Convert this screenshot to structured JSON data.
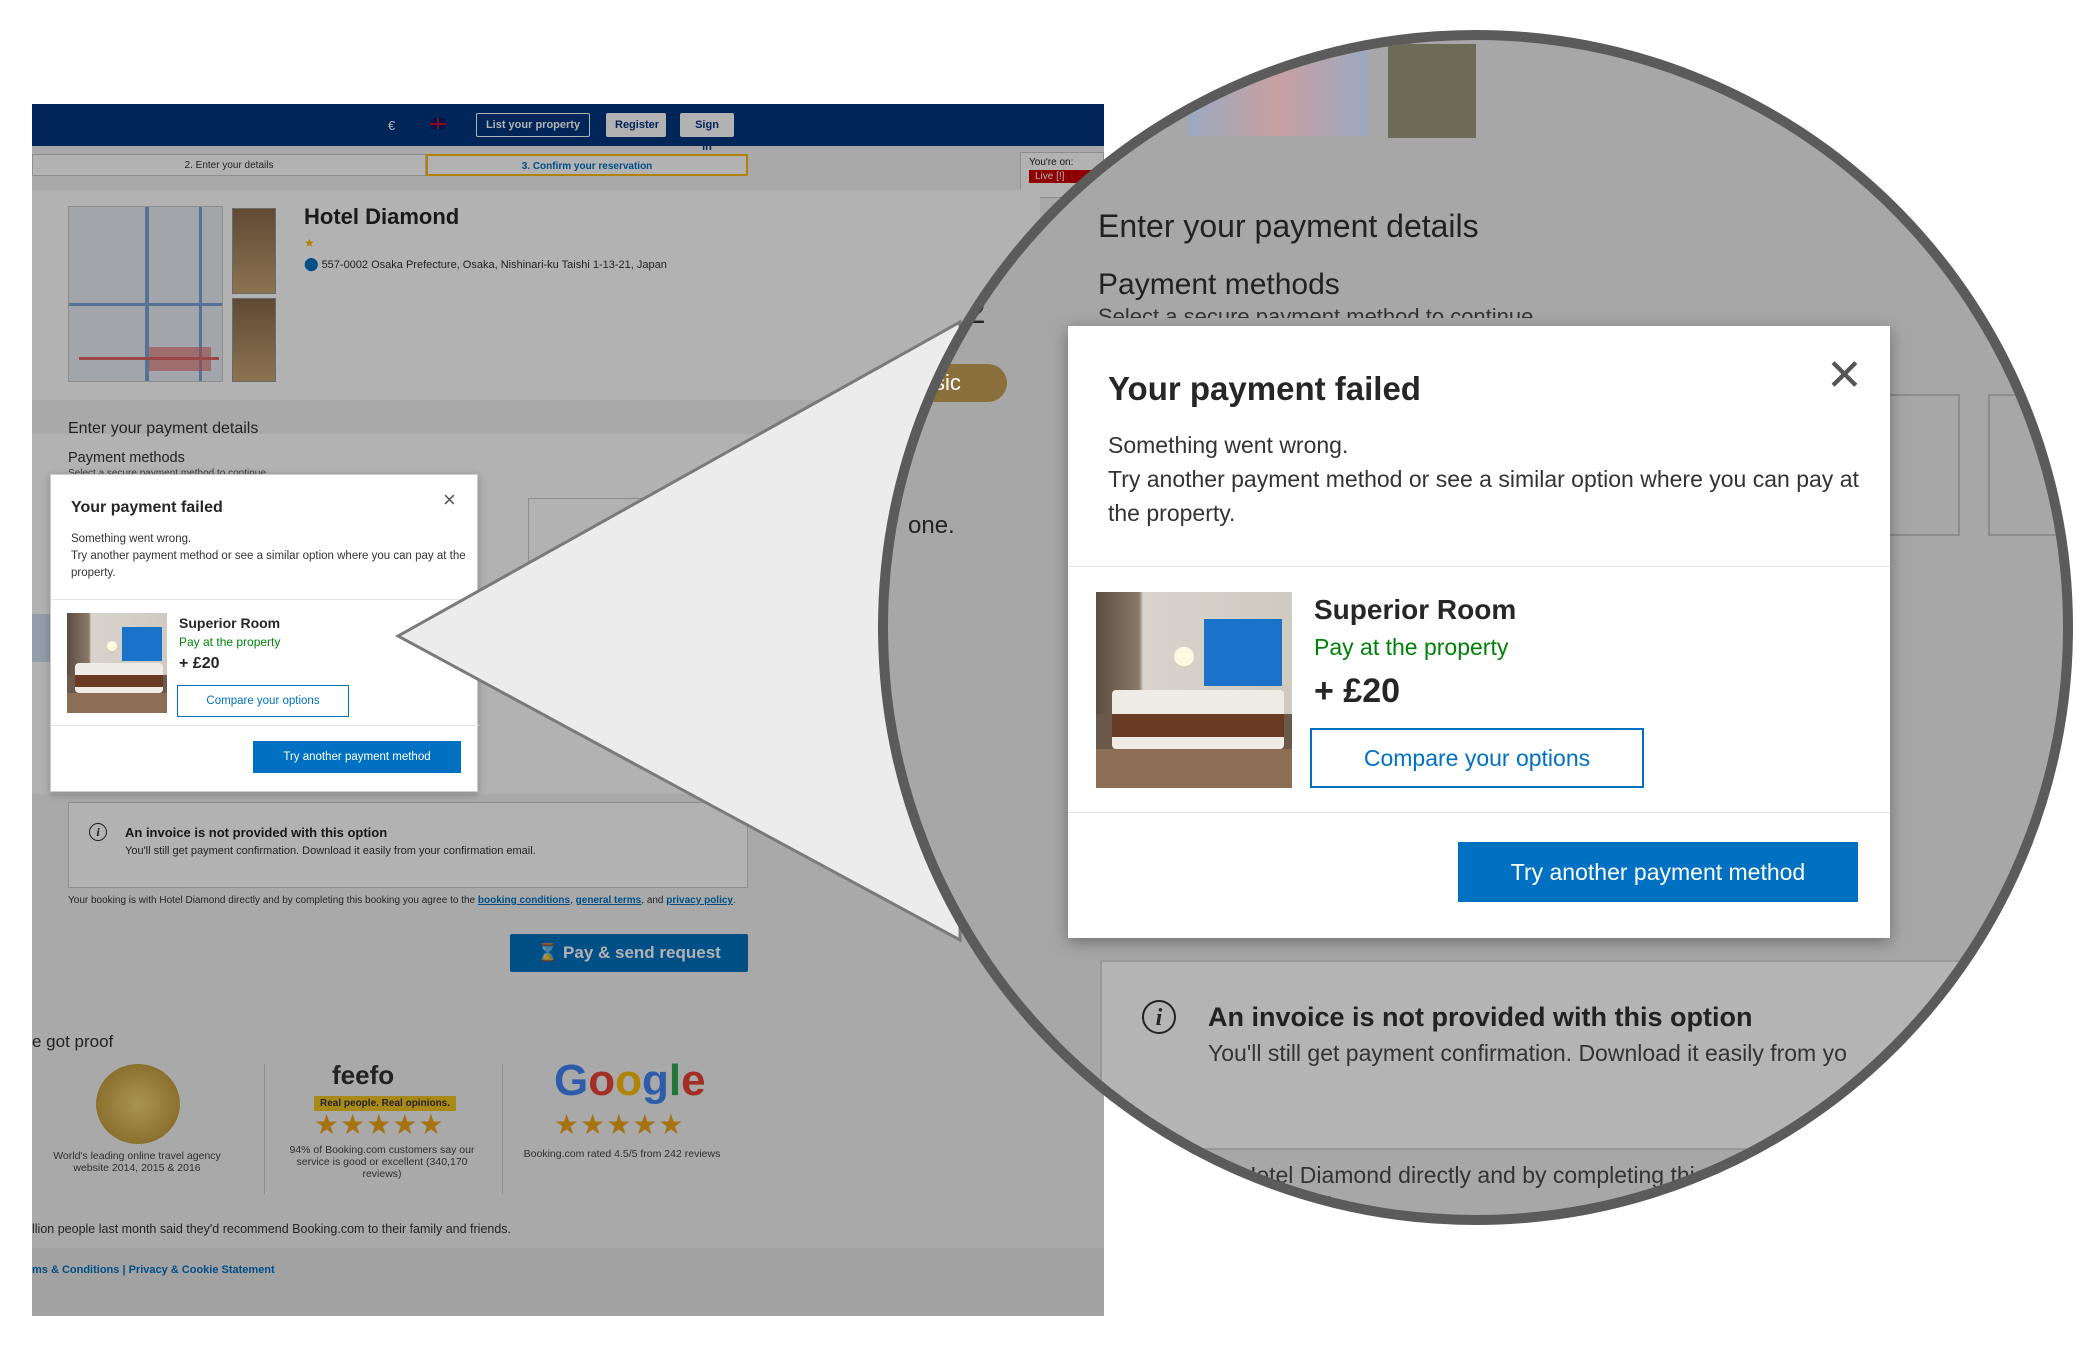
{
  "left_screenshot": {
    "topbar": {
      "currency": "€",
      "language_flag": "uk-flag-icon",
      "list_property": "List your property",
      "register": "Register",
      "sign_in": "Sign in"
    },
    "steps": [
      "2. Enter your details",
      "3. Confirm your reservation"
    ],
    "live_badge": {
      "label": "You're on:",
      "button": "Live [!]"
    },
    "hotel": {
      "name": "Hotel Diamond",
      "stars": "★",
      "address": "557-0002 Osaka Prefecture, Osaka, Nishinari-ku Taishi 1-13-21, Japan"
    },
    "payment": {
      "heading": "Enter your payment details",
      "methods": "Payment methods",
      "subtitle": "Select a secure payment method to continue"
    },
    "modal": {
      "title": "Your payment failed",
      "close": "×",
      "body_line1": "Something went wrong.",
      "body_line2": "Try another payment method or see a similar option where you can pay at the property.",
      "room_title": "Superior Room",
      "room_pay": "Pay at the property",
      "room_price": "+ £20",
      "compare_button": "Compare your options",
      "try_button": "Try another payment method"
    },
    "invoice": {
      "title": "An invoice is not provided with this option",
      "body": "You'll still get payment confirmation. Download it easily from your confirmation email."
    },
    "terms": {
      "prefix": "Your booking is with Hotel Diamond directly and by completing this booking you agree to the",
      "booking_conditions": "booking conditions",
      "general_terms": "general terms",
      "and": "and",
      "privacy_policy": "privacy policy"
    },
    "pay_button": "Pay & send request",
    "proof": {
      "heading": "e got proof",
      "award_text": "World's leading online travel agency website 2014, 2015 & 2016",
      "feefo_logo": "feefo",
      "feefo_tag": "Real people. Real opinions.",
      "feefo_stars": "★★★★★",
      "feefo_text": "94% of Booking.com customers say our service is good or excellent (340,170 reviews)",
      "google_logo": "Google",
      "google_stars": "★★★★★",
      "google_text": "Booking.com rated 4.5/5 from 242 reviews"
    },
    "recommend": "llion people last month said they'd recommend Booking.com to their family and friends.",
    "footer": "ms & Conditions | Privacy & Cookie Statement"
  },
  "zoom": {
    "heading": "Enter your payment details",
    "methods": "Payment methods",
    "subtitle": "Select a secure payment method to continue",
    "modal": {
      "title": "Your payment failed",
      "close": "✕",
      "body_line1": "Something went wrong.",
      "body_line2": "Try another payment method or see a similar option where you can pay at the property.",
      "room_title": "Superior Room",
      "room_pay": "Pay at the property",
      "room_price": "+ £20",
      "compare_button": "Compare your options",
      "try_button": "Try another payment method"
    },
    "invoice": {
      "title": "An invoice is not provided with this option",
      "body": "You'll still get payment confirmation. Download it easily from yo"
    },
    "terms_fragment": "oking is with Hotel Diamond directly and by completing this b",
    "privacy_policy": "privacy policy",
    "side_fragments": {
      "date": "22",
      "basic": "sic",
      "done": "one."
    }
  },
  "colors": {
    "brand_blue": "#003580",
    "button_blue": "#0071c2",
    "green": "#008009",
    "yellow": "#febb02"
  }
}
